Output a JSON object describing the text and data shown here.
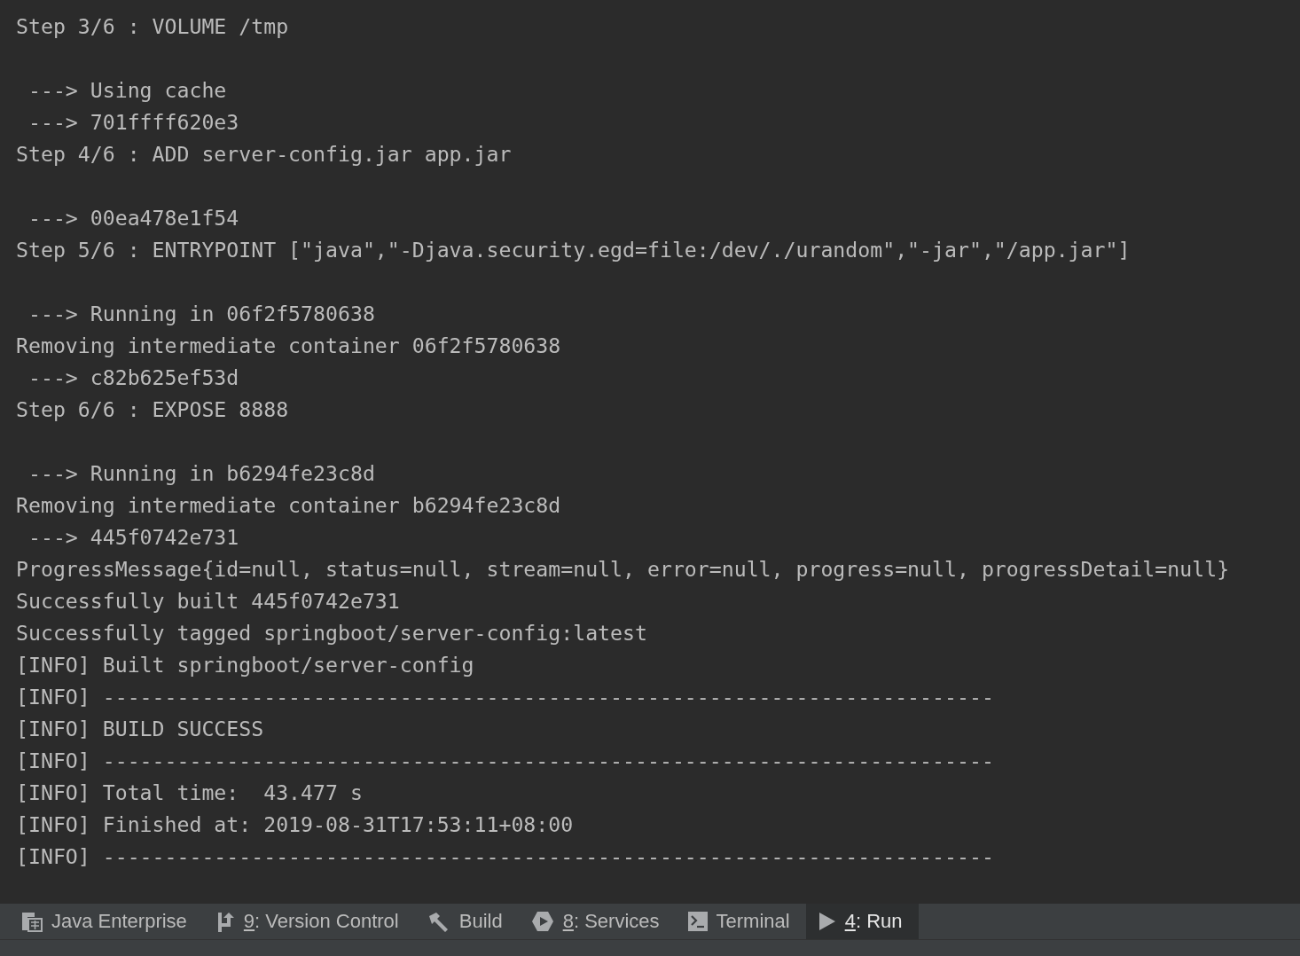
{
  "console": {
    "blocks": [
      [
        "Step 3/6 : VOLUME /tmp"
      ],
      [
        " ---> Using cache",
        " ---> 701ffff620e3",
        "Step 4/6 : ADD server-config.jar app.jar"
      ],
      [
        " ---> 00ea478e1f54",
        "Step 5/6 : ENTRYPOINT [\"java\",\"-Djava.security.egd=file:/dev/./urandom\",\"-jar\",\"/app.jar\"]"
      ],
      [
        " ---> Running in 06f2f5780638",
        "Removing intermediate container 06f2f5780638",
        " ---> c82b625ef53d",
        "Step 6/6 : EXPOSE 8888"
      ],
      [
        " ---> Running in b6294fe23c8d",
        "Removing intermediate container b6294fe23c8d",
        " ---> 445f0742e731",
        "ProgressMessage{id=null, status=null, stream=null, error=null, progress=null, progressDetail=null}",
        "Successfully built 445f0742e731",
        "Successfully tagged springboot/server-config:latest",
        "[INFO] Built springboot/server-config",
        "[INFO] ------------------------------------------------------------------------",
        "[INFO] BUILD SUCCESS",
        "[INFO] ------------------------------------------------------------------------",
        "[INFO] Total time:  43.477 s",
        "[INFO] Finished at: 2019-08-31T17:53:11+08:00",
        "[INFO] ------------------------------------------------------------------------"
      ]
    ]
  },
  "tool_tabs": [
    {
      "kind": "enterprise",
      "label": "Java Enterprise",
      "selected": false
    },
    {
      "kind": "vcs",
      "mnemonic": "9",
      "label": ": Version Control",
      "selected": false
    },
    {
      "kind": "build",
      "label": "Build",
      "selected": false
    },
    {
      "kind": "services",
      "mnemonic": "8",
      "label": ": Services",
      "selected": false
    },
    {
      "kind": "terminal",
      "label": "Terminal",
      "selected": false
    },
    {
      "kind": "run",
      "mnemonic": "4",
      "label": ": Run",
      "selected": true
    }
  ]
}
